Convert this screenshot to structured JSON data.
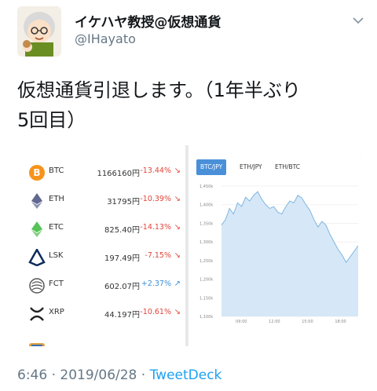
{
  "tweet": {
    "display_name": "イケハヤ教授@仮想通貨",
    "handle": "@IHayato",
    "text_line1": "仮想通貨引退します。（1年半ぶり",
    "text_line2": "5回目）",
    "timestamp": "6:46 · 2019/06/28 · ",
    "source": "TweetDeck"
  },
  "icons": {
    "avatar": "cartoon-avatar",
    "menu": "chevron-down-icon"
  },
  "coins": [
    {
      "symbol": "BTC",
      "price": "1166160円",
      "change": "-13.44%",
      "direction": "down",
      "icon": "bitcoin-icon",
      "color": "#f7931a"
    },
    {
      "symbol": "ETH",
      "price": "31795円",
      "change": "-10.39%",
      "direction": "down",
      "icon": "ethereum-icon",
      "color": "#62688f"
    },
    {
      "symbol": "ETC",
      "price": "825.40円",
      "change": "-14.13%",
      "direction": "down",
      "icon": "ethereum-classic-icon",
      "color": "#3ab83a"
    },
    {
      "symbol": "LSK",
      "price": "197.49円",
      "change": "-7.15%",
      "direction": "down",
      "icon": "lisk-icon",
      "color": "#0d2c5b"
    },
    {
      "symbol": "FCT",
      "price": "602.07円",
      "change": "+2.37%",
      "direction": "up",
      "icon": "factom-icon",
      "color": "#555555"
    },
    {
      "symbol": "XRP",
      "price": "44.197円",
      "change": "-10.61%",
      "direction": "down",
      "icon": "ripple-icon",
      "color": "#222222"
    }
  ],
  "chart_tabs": [
    "BTC/JPY",
    "ETH/JPY",
    "ETH/BTC"
  ],
  "arrow_down": "↘",
  "arrow_up": "↗",
  "chart_data": {
    "type": "area",
    "title": "",
    "xlabel": "",
    "ylabel": "",
    "x_ticks": [
      "09:00",
      "12:00",
      "15:00",
      "18:00"
    ],
    "y_ticks": [
      "1,100k",
      "1,150k",
      "1,200k",
      "1,250k",
      "1,300k",
      "1,350k",
      "1,400k",
      "1,450k"
    ],
    "ylim": [
      1100,
      1450
    ],
    "series": [
      {
        "values": [
          1345,
          1360,
          1390,
          1375,
          1405,
          1395,
          1420,
          1410,
          1425,
          1435,
          1415,
          1400,
          1390,
          1395,
          1380,
          1375,
          1395,
          1410,
          1405,
          1425,
          1418,
          1400,
          1385,
          1360,
          1340,
          1355,
          1345,
          1320,
          1300,
          1280,
          1265,
          1245,
          1260,
          1275,
          1290
        ],
        "x_range": [
          7.2,
          19.6
        ]
      }
    ],
    "grid": true,
    "color": "#7fb5e0"
  }
}
